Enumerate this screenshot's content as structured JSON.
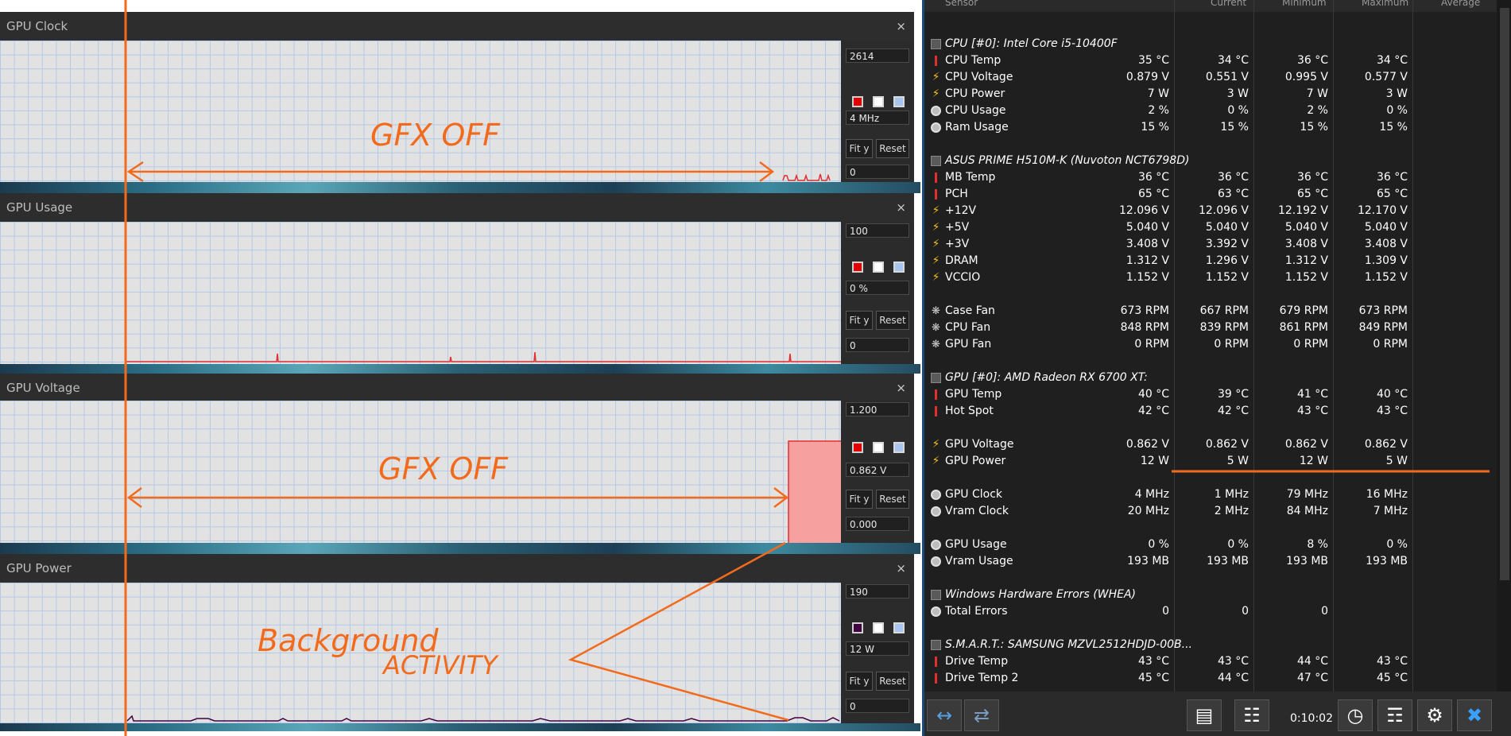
{
  "panels": [
    {
      "title": "GPU Clock",
      "max": "2614",
      "current": "4 MHz",
      "min": "0",
      "fit": "Fit y",
      "reset": "Reset"
    },
    {
      "title": "GPU Usage",
      "max": "100",
      "current": "0 %",
      "min": "0",
      "fit": "Fit y",
      "reset": "Reset"
    },
    {
      "title": "GPU Voltage",
      "max": "1.200",
      "current": "0.862 V",
      "min": "0.000",
      "fit": "Fit y",
      "reset": "Reset"
    },
    {
      "title": "GPU Power",
      "max": "190",
      "current": "12 W",
      "min": "0",
      "fit": "Fit y",
      "reset": "Reset"
    }
  ],
  "close_glyph": "×",
  "annotations": {
    "gfx1": "GFX OFF",
    "gfx2": "GFX OFF",
    "bg1": "Background",
    "bg2": "ACTIVITY"
  },
  "hwinfo": {
    "header": {
      "sensor": "Sensor",
      "current": "Current",
      "min": "Minimum",
      "max": "Maximum",
      "avg": "Average"
    },
    "groups": [
      {
        "title": "CPU [#0]: Intel Core i5-10400F",
        "rows": [
          [
            "therm",
            "CPU Temp",
            "35 °C",
            "34 °C",
            "36 °C",
            "34 °C"
          ],
          [
            "bolt",
            "CPU Voltage",
            "0.879 V",
            "0.551 V",
            "0.995 V",
            "0.577 V"
          ],
          [
            "bolt",
            "CPU Power",
            "7 W",
            "3 W",
            "7 W",
            "3 W"
          ],
          [
            "circ",
            "CPU Usage",
            "2 %",
            "0 %",
            "2 %",
            "0 %"
          ],
          [
            "circ",
            "Ram Usage",
            "15 %",
            "15 %",
            "15 %",
            "15 %"
          ]
        ]
      },
      {
        "title": "ASUS PRIME H510M-K (Nuvoton NCT6798D)",
        "rows": [
          [
            "therm",
            "MB Temp",
            "36 °C",
            "36 °C",
            "36 °C",
            "36 °C"
          ],
          [
            "therm",
            "PCH",
            "65 °C",
            "63 °C",
            "65 °C",
            "65 °C"
          ],
          [
            "bolt",
            "+12V",
            "12.096 V",
            "12.096 V",
            "12.192 V",
            "12.170 V"
          ],
          [
            "bolt",
            "+5V",
            "5.040 V",
            "5.040 V",
            "5.040 V",
            "5.040 V"
          ],
          [
            "bolt",
            "+3V",
            "3.408 V",
            "3.392 V",
            "3.408 V",
            "3.408 V"
          ],
          [
            "bolt",
            "DRAM",
            "1.312 V",
            "1.296 V",
            "1.312 V",
            "1.309 V"
          ],
          [
            "bolt",
            "VCCIO",
            "1.152 V",
            "1.152 V",
            "1.152 V",
            "1.152 V"
          ],
          [
            "blank",
            "",
            "",
            "",
            "",
            ""
          ],
          [
            "fan",
            "Case Fan",
            "673 RPM",
            "667 RPM",
            "679 RPM",
            "673 RPM"
          ],
          [
            "fan",
            "CPU Fan",
            "848 RPM",
            "839 RPM",
            "861 RPM",
            "849 RPM"
          ],
          [
            "fan",
            "GPU Fan",
            "0 RPM",
            "0 RPM",
            "0 RPM",
            "0 RPM"
          ]
        ]
      },
      {
        "title": "GPU [#0]: AMD Radeon RX 6700 XT:",
        "rows": [
          [
            "therm",
            "GPU Temp",
            "40 °C",
            "39 °C",
            "41 °C",
            "40 °C"
          ],
          [
            "therm",
            "Hot Spot",
            "42 °C",
            "42 °C",
            "43 °C",
            "43 °C"
          ],
          [
            "blank",
            "",
            "",
            "",
            "",
            ""
          ],
          [
            "bolt",
            "GPU Voltage",
            "0.862 V",
            "0.862 V",
            "0.862 V",
            "0.862 V"
          ],
          [
            "bolt",
            "GPU Power",
            "12 W",
            "5 W",
            "12 W",
            "5 W"
          ],
          [
            "blank",
            "",
            "",
            "",
            "",
            ""
          ],
          [
            "circ",
            "GPU Clock",
            "4 MHz",
            "1 MHz",
            "79 MHz",
            "16 MHz"
          ],
          [
            "circ",
            "Vram Clock",
            "20 MHz",
            "2 MHz",
            "84 MHz",
            "7 MHz"
          ],
          [
            "blank",
            "",
            "",
            "",
            "",
            ""
          ],
          [
            "circ",
            "GPU Usage",
            "0 %",
            "0 %",
            "8 %",
            "0 %"
          ],
          [
            "circ",
            "Vram Usage",
            "193 MB",
            "193 MB",
            "193 MB",
            "193 MB"
          ]
        ]
      },
      {
        "title": "Windows Hardware Errors (WHEA)",
        "rows": [
          [
            "circ",
            "Total Errors",
            "0",
            "0",
            "0",
            ""
          ]
        ]
      },
      {
        "title": "S.M.A.R.T.: SAMSUNG MZVL2512HDJD-00B...",
        "rows": [
          [
            "therm",
            "Drive Temp",
            "43 °C",
            "43 °C",
            "44 °C",
            "43 °C"
          ],
          [
            "therm",
            "Drive Temp 2",
            "45 °C",
            "44 °C",
            "47 °C",
            "45 °C"
          ]
        ]
      }
    ],
    "timer": "0:10:02"
  }
}
